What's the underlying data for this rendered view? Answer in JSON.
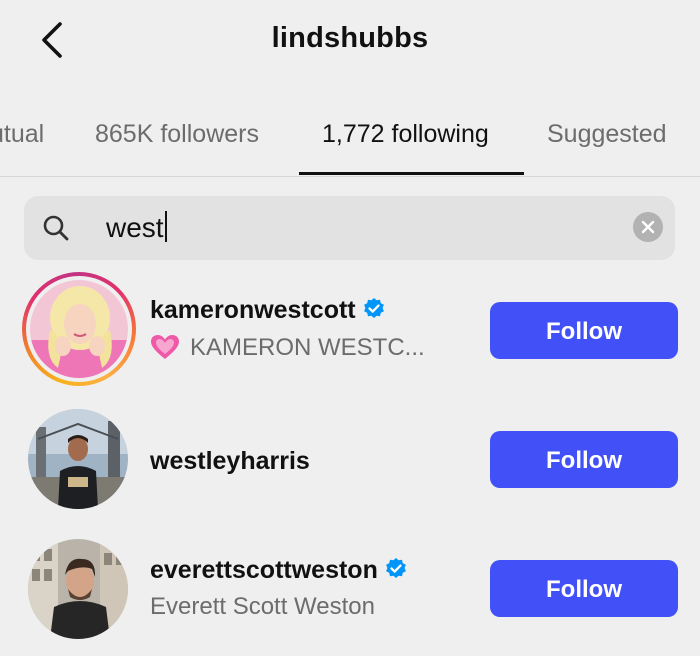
{
  "header": {
    "title": "lindshubbs",
    "back_icon": "chevron-left-icon"
  },
  "tabs": [
    {
      "label": "utual",
      "active": false
    },
    {
      "label": "865K followers",
      "active": false
    },
    {
      "label": "1,772 following",
      "active": true
    },
    {
      "label": "Suggested",
      "active": false
    }
  ],
  "search": {
    "value": "west",
    "icon": "search-icon",
    "clear_icon": "clear-icon"
  },
  "results": [
    {
      "username": "kameronwestcott",
      "verified": true,
      "subtitle": "KAMERON WESTC...",
      "subtitle_icon": "pink-heart-icon",
      "has_story_ring": true,
      "action": "Follow"
    },
    {
      "username": "westleyharris",
      "verified": false,
      "subtitle": "",
      "has_story_ring": false,
      "action": "Follow"
    },
    {
      "username": "everettscottweston",
      "verified": true,
      "subtitle": "Everett Scott Weston",
      "has_story_ring": false,
      "action": "Follow"
    }
  ],
  "colors": {
    "background": "#efefef",
    "follow_button": "#4150f7",
    "verified_badge": "#0095f6",
    "secondary_text": "#6c6c6c"
  }
}
